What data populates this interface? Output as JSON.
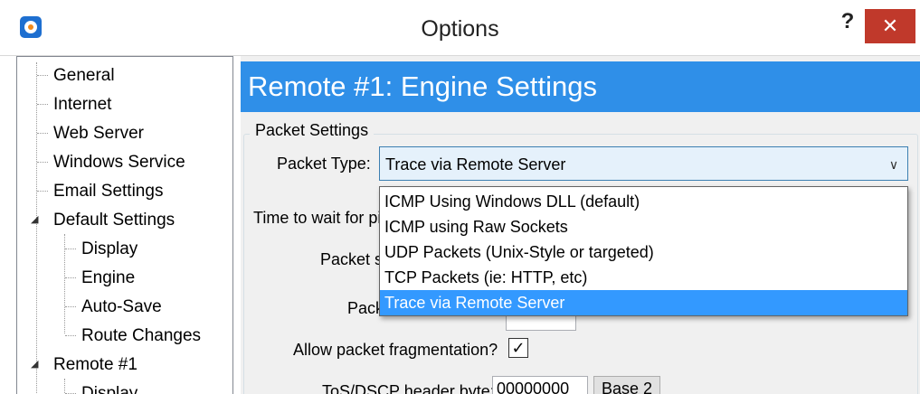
{
  "window": {
    "title": "Options",
    "help_label": "?",
    "close_label": "✕"
  },
  "tree": {
    "items": [
      {
        "label": "General"
      },
      {
        "label": "Internet"
      },
      {
        "label": "Web Server"
      },
      {
        "label": "Windows Service"
      },
      {
        "label": "Email Settings"
      },
      {
        "label": "Default Settings"
      },
      {
        "label": "Display"
      },
      {
        "label": "Engine"
      },
      {
        "label": "Auto-Save"
      },
      {
        "label": "Route Changes"
      },
      {
        "label": "Remote #1"
      },
      {
        "label": "Display"
      }
    ],
    "expander_glyph": "◢"
  },
  "main": {
    "header": "Remote #1: Engine Settings",
    "group_label": "Packet Settings",
    "packet_type_label": "Packet Type:",
    "packet_type_value": "Trace via Remote Server",
    "time_wait_label": "Time to wait for pi",
    "packet_size_label": "Packet s",
    "packet_pack_label": "Pack",
    "fragmentation_label": "Allow packet fragmentation?",
    "fragmentation_checked": true,
    "check_glyph": "✓",
    "tos_label": "ToS/DSCP header byte:",
    "tos_value": "00000000",
    "base_button": "Base 2"
  },
  "dropdown": {
    "options": [
      "ICMP Using Windows DLL (default)",
      "ICMP using Raw Sockets",
      "UDP Packets (Unix-Style or targeted)",
      "TCP Packets (ie: HTTP, etc)",
      "Trace via Remote Server"
    ],
    "selected_index": 4
  },
  "colors": {
    "header_bg": "#2f8fe8",
    "close_bg": "#c0392b",
    "selection_bg": "#3399ff"
  }
}
